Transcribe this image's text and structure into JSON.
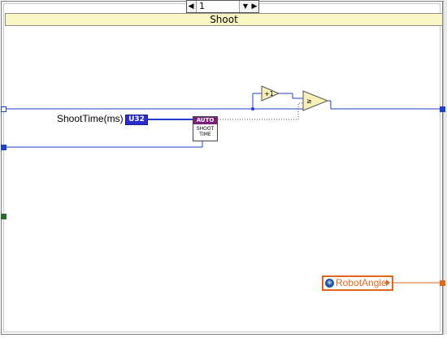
{
  "case_structure": {
    "selector_value": "1",
    "case_name": "Shoot"
  },
  "nodes": {
    "increment_label": "+1",
    "constant_label": "ShootTime(ms)",
    "constant_type": "U32",
    "subvi_header": "AUTO",
    "subvi_line1": "SHOOT",
    "subvi_line2": "TIME",
    "local_variable": "RobotAngle"
  },
  "colors": {
    "case_label_bg": "#fbf7c5",
    "numeric_wire": "#1f3fd1",
    "boolean_wire": "#2a6a2a",
    "cluster_wire": "#e2661a",
    "subvi_header": "#7b1f7b"
  }
}
